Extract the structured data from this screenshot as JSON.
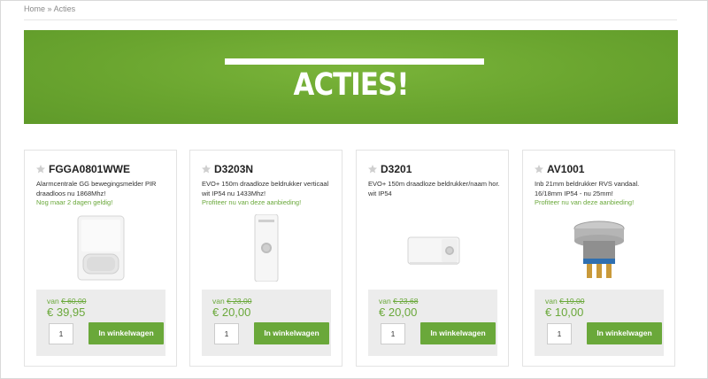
{
  "breadcrumb": {
    "home": "Home",
    "separator": "»",
    "current": "Acties"
  },
  "banner": {
    "title": "ACTIES!"
  },
  "colors": {
    "accent": "#6aa83a",
    "banner": "#6aa52f",
    "price_panel": "#ececec"
  },
  "products": [
    {
      "sku": "FGGA0801WWE",
      "description": "Alarmcentrale GG bewegingsmelder PIR draadloos nu 1868Mhz!",
      "promo": "Nog maar 2 dagen geldig!",
      "image_icon": "pir-motion-sensor",
      "from_label": "van",
      "old_price": "€ 60,00",
      "new_price": "€ 39,95",
      "quantity": "1",
      "cart_label": "In winkelwagen"
    },
    {
      "sku": "D3203N",
      "description": "EVO+ 150m draadloze beldrukker verticaal wit IP54 nu 1433Mhz!",
      "promo": "Profiteer nu van deze aanbieding!",
      "image_icon": "vertical-doorbell-push",
      "from_label": "van",
      "old_price": "€ 23,00",
      "new_price": "€ 20,00",
      "quantity": "1",
      "cart_label": "In winkelwagen"
    },
    {
      "sku": "D3201",
      "description": "EVO+ 150m draadloze beldrukker/naam hor. wit IP54",
      "promo": "",
      "image_icon": "horizontal-doorbell-push",
      "from_label": "van",
      "old_price": "€ 23,68",
      "new_price": "€ 20,00",
      "quantity": "1",
      "cart_label": "In winkelwagen"
    },
    {
      "sku": "AV1001",
      "description": "Inb 21mm beldrukker RVS vandaal. 16/18mm IP54 - nu 25mm!",
      "promo": "Profiteer nu van deze aanbieding!",
      "image_icon": "stainless-push-button",
      "from_label": "van",
      "old_price": "€ 19,00",
      "new_price": "€ 10,00",
      "quantity": "1",
      "cart_label": "In winkelwagen"
    }
  ]
}
